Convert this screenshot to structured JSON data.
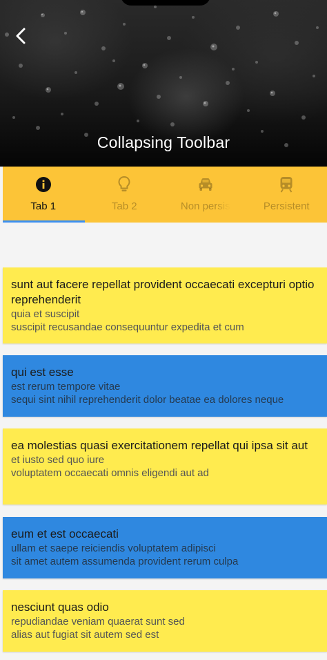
{
  "toolbar": {
    "title": "Collapsing Toolbar",
    "back_icon": "chevron-left-icon"
  },
  "tabs": [
    {
      "label": "Tab 1",
      "icon": "info-icon",
      "active": true
    },
    {
      "label": "Tab 2",
      "icon": "lightbulb-icon",
      "active": false
    },
    {
      "label": "Non persis",
      "icon": "car-icon",
      "active": false
    },
    {
      "label": "Persistent",
      "icon": "train-icon",
      "active": false
    }
  ],
  "posts": [
    {
      "title": "sunt aut facere repellat provident occaecati excepturi optio reprehenderit",
      "line1": "quia et suscipit",
      "line2": "suscipit recusandae consequuntur expedita et cum",
      "color": "#ffeb4f"
    },
    {
      "title": "qui est esse",
      "line1": "est rerum tempore vitae",
      "line2": "sequi sint nihil reprehenderit dolor beatae ea dolores neque",
      "color": "#2f88e0"
    },
    {
      "title": "ea molestias quasi exercitationem repellat qui ipsa sit aut",
      "line1": "et iusto sed quo iure",
      "line2": "voluptatem occaecati omnis eligendi aut ad",
      "color": "#ffeb4f"
    },
    {
      "title": "eum et est occaecati",
      "line1": "ullam et saepe reiciendis voluptatem adipisci",
      "line2": "sit amet autem assumenda provident rerum culpa",
      "color": "#2f88e0"
    },
    {
      "title": "nesciunt quas odio",
      "line1": "repudiandae veniam quaerat sunt sed",
      "line2": "alias aut fugiat sit autem sed est",
      "color": "#ffeb4f"
    }
  ],
  "colors": {
    "tabbar": "#fcc437",
    "indicator": "#3b8ff0",
    "card_yellow": "#ffeb4f",
    "card_blue": "#2f88e0"
  }
}
